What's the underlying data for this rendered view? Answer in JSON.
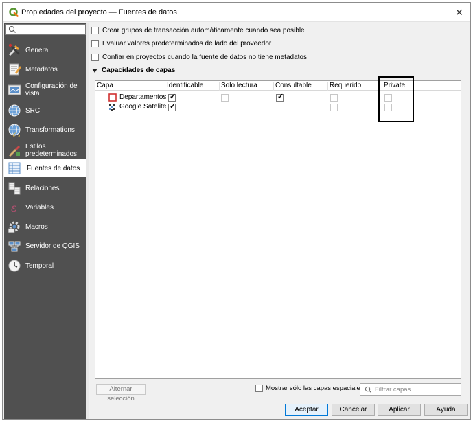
{
  "window": {
    "title": "Propiedades del proyecto — Fuentes de datos",
    "close_glyph": "✕"
  },
  "sidebar": {
    "search_placeholder": "",
    "items": [
      {
        "label": "General",
        "icon": "tools-icon"
      },
      {
        "label": "Metadatos",
        "icon": "metadata-icon"
      },
      {
        "label": "Configuración de vista",
        "icon": "view-settings-icon"
      },
      {
        "label": "SRC",
        "icon": "globe-icon"
      },
      {
        "label": "Transformations",
        "icon": "transform-globe-icon"
      },
      {
        "label": "Estilos predeterminados",
        "icon": "styles-icon"
      },
      {
        "label": "Fuentes de datos",
        "icon": "datasources-icon"
      },
      {
        "label": "Relaciones",
        "icon": "relations-icon"
      },
      {
        "label": "Variables",
        "icon": "variables-icon"
      },
      {
        "label": "Macros",
        "icon": "macros-icon"
      },
      {
        "label": "Servidor de QGIS",
        "icon": "server-icon"
      },
      {
        "label": "Temporal",
        "icon": "clock-icon"
      }
    ],
    "active_index": 6
  },
  "options": {
    "transaction_groups": "Crear grupos de transacción automáticamente cuando sea posible",
    "provider_defaults": "Evaluar valores predeterminados de lado del proveedor",
    "trust_project": "Confiar en proyectos cuando la fuente de datos no tiene metadatos"
  },
  "layer_capabilities": {
    "section_title": "Capacidades de capas",
    "columns": [
      "Capa",
      "Identificable",
      "Solo lectura",
      "Consultable",
      "Requerido",
      "Private"
    ],
    "rows": [
      {
        "name": "Departamentos",
        "identificable": true,
        "solo_lectura": false,
        "consultable": true,
        "requerido": false,
        "private": false
      },
      {
        "name": "Google Satelite",
        "identificable": true,
        "solo_lectura": null,
        "consultable": null,
        "requerido": false,
        "private": false
      }
    ]
  },
  "table_footer": {
    "toggle_selection": "Alternar selección",
    "spatial_only": "Mostrar sólo las capas espaciales",
    "filter_placeholder": "Filtrar capas..."
  },
  "buttons": {
    "accept": "Aceptar",
    "cancel": "Cancelar",
    "apply": "Aplicar",
    "help": "Ayuda"
  },
  "colors": {
    "sidebar_bg": "#505050",
    "qgis_green": "#589632",
    "default_button_border": "#0078d7"
  }
}
